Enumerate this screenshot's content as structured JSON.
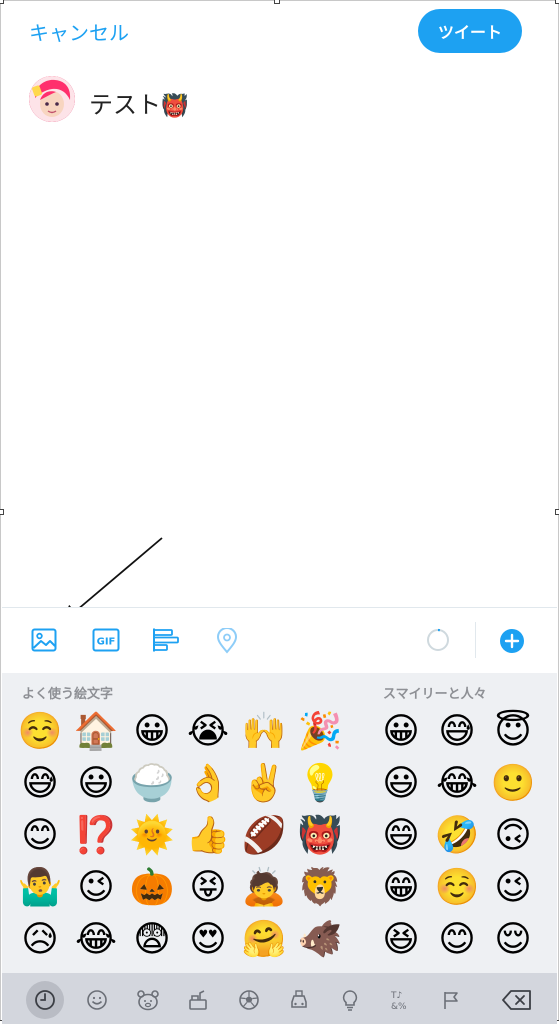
{
  "header": {
    "cancel_label": "キャンセル",
    "tweet_label": "ツイート"
  },
  "compose": {
    "text": "テスト",
    "emoji": "👹"
  },
  "toolbar": {
    "icons": [
      "image-icon",
      "gif-icon",
      "poll-icon",
      "location-icon",
      "character-counter-icon",
      "add-thread-icon"
    ],
    "gif_label": "GIF"
  },
  "keyboard": {
    "section_recent": "よく使う絵文字",
    "section_smileys": "スマイリーと人々",
    "recent_emojis": [
      [
        "☺️",
        "🏠",
        "😀",
        "😭",
        "🙌",
        "🎉"
      ],
      [
        "😅",
        "😃",
        "🍚",
        "👌",
        "✌️",
        "💡"
      ],
      [
        "😊",
        "⁉️",
        "🌞",
        "👍",
        "🏈",
        "👹"
      ],
      [
        "🤷‍♂️",
        "😉",
        "🎃",
        "😝",
        "🙇",
        "🦁"
      ],
      [
        "😥",
        "😂",
        "😨",
        "😍",
        "🤗",
        "🐗"
      ]
    ],
    "smiley_emojis": [
      [
        "😀",
        "😅",
        "😇"
      ],
      [
        "😃",
        "😂",
        "🙂"
      ],
      [
        "😄",
        "🤣",
        "🙃"
      ],
      [
        "😁",
        "☺️",
        "😉"
      ],
      [
        "😆",
        "😊",
        "😌"
      ]
    ],
    "categories": [
      "🕘",
      "☺",
      "🐻",
      "🍔",
      "⚽",
      "🚘",
      "💡",
      "♪",
      "⚐",
      "⌫"
    ],
    "category_symbols_label": "&%"
  },
  "colors": {
    "accent": "#1da1f2",
    "keyboard_bg": "#eef0f3",
    "category_bar_bg": "#d3d6dd"
  }
}
